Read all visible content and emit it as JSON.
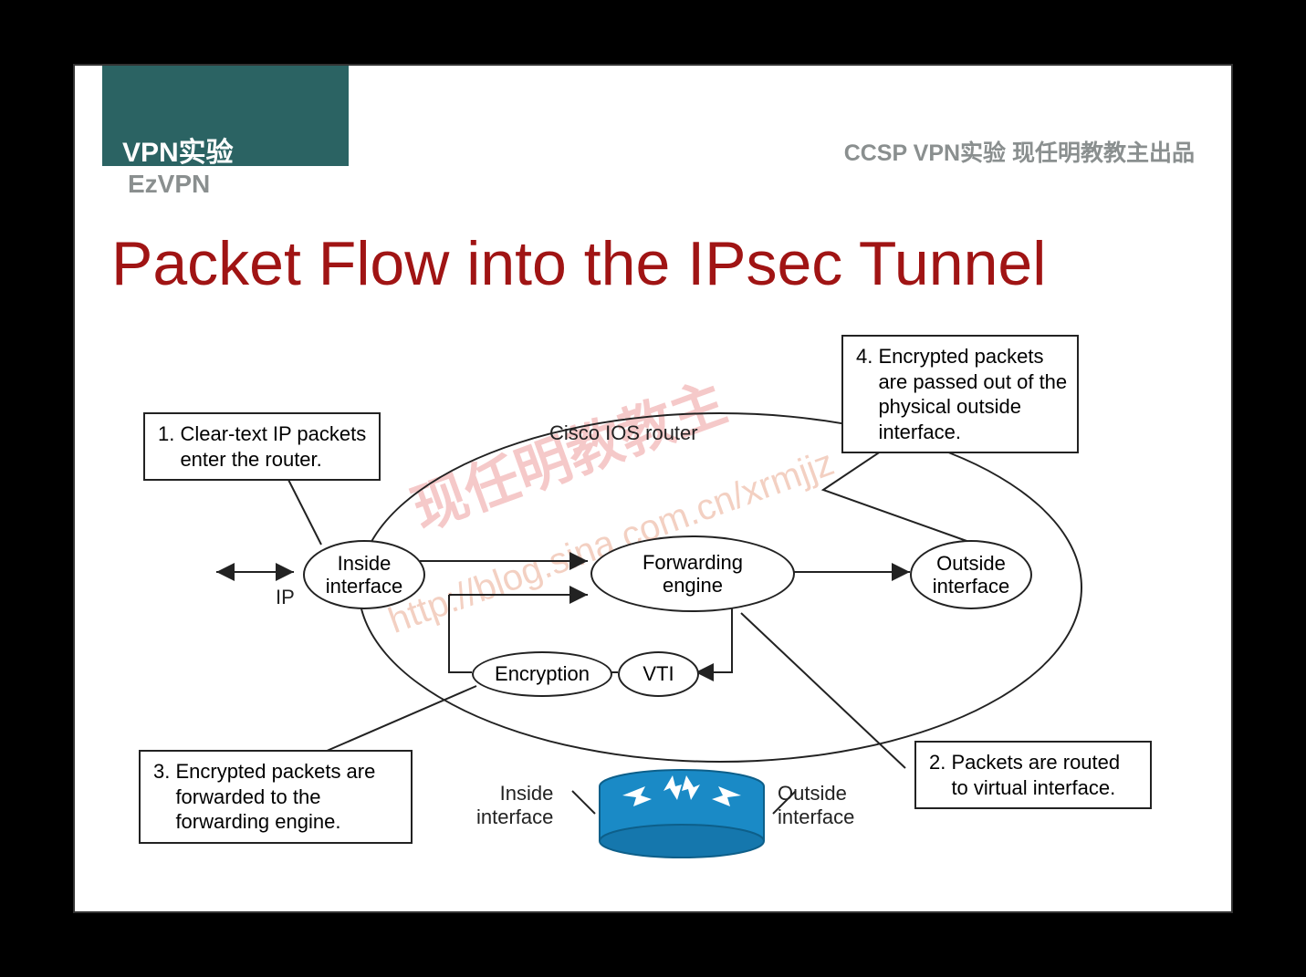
{
  "header": {
    "vpn_label": "VPN实验",
    "ezvpn_label": "EzVPN",
    "ccsp_label": "CCSP VPN实验 现任明教教主出品"
  },
  "title": "Packet Flow into the IPsec Tunnel",
  "diagram": {
    "router_label": "Cisco IOS router",
    "ip_label": "IP",
    "nodes": {
      "inside_interface": "Inside\ninterface",
      "forwarding_engine": "Forwarding\nengine",
      "outside_interface": "Outside\ninterface",
      "encryption": "Encryption",
      "vti": "VTI"
    },
    "router_bottom": {
      "inside_label": "Inside\ninterface",
      "outside_label": "Outside\ninterface"
    },
    "callouts": {
      "c1": "1. Clear-text IP packets\n    enter the router.",
      "c2": "2. Packets are routed\n    to virtual interface.",
      "c3": "3. Encrypted packets are\n    forwarded to the\n    forwarding engine.",
      "c4": "4. Encrypted packets\n    are passed out of the\n    physical outside\n    interface."
    },
    "watermark_text": "现任明教教主",
    "watermark_url": "http://blog.sina.com.cn/xrmjjz"
  }
}
